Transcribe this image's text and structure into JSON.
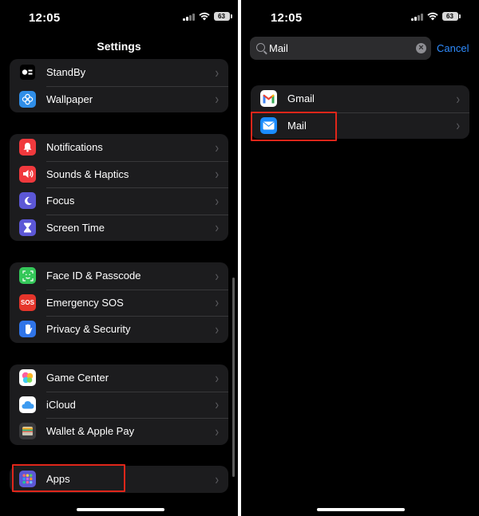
{
  "left_screen": {
    "status": {
      "time": "12:05",
      "battery": "63"
    },
    "title": "Settings",
    "groups": [
      {
        "items": [
          {
            "label": "StandBy",
            "icon": "standby-icon",
            "color": "#1c1c1e"
          },
          {
            "label": "Wallpaper",
            "icon": "wallpaper-icon",
            "color": "#2f8ee8"
          }
        ]
      },
      {
        "items": [
          {
            "label": "Notifications",
            "icon": "bell-icon",
            "color": "#f0393d"
          },
          {
            "label": "Sounds & Haptics",
            "icon": "speaker-icon",
            "color": "#f0393d"
          },
          {
            "label": "Focus",
            "icon": "moon-icon",
            "color": "#5c57d6"
          },
          {
            "label": "Screen Time",
            "icon": "hourglass-icon",
            "color": "#5c57d6"
          }
        ]
      },
      {
        "items": [
          {
            "label": "Face ID & Passcode",
            "icon": "faceid-icon",
            "color": "#34c759"
          },
          {
            "label": "Emergency SOS",
            "icon": "sos-icon",
            "color": "#e5352b",
            "icon_text": "SOS"
          },
          {
            "label": "Privacy & Security",
            "icon": "hand-icon",
            "color": "#2f74e8"
          }
        ]
      },
      {
        "items": [
          {
            "label": "Game Center",
            "icon": "game-center-icon",
            "color": "#ffffff"
          },
          {
            "label": "iCloud",
            "icon": "cloud-icon",
            "color": "#ffffff"
          },
          {
            "label": "Wallet & Apple Pay",
            "icon": "wallet-icon",
            "color": "#3a3a3c"
          }
        ]
      },
      {
        "items": [
          {
            "label": "Apps",
            "icon": "apps-grid-icon",
            "color": "#5c57d6"
          }
        ]
      }
    ]
  },
  "right_screen": {
    "status": {
      "time": "12:05",
      "battery": "63"
    },
    "search": {
      "value": "Mail"
    },
    "cancel_label": "Cancel",
    "results": [
      {
        "label": "Gmail",
        "icon": "gmail-icon",
        "color": "#ffffff"
      },
      {
        "label": "Mail",
        "icon": "mail-envelope-icon",
        "color": "#1a8cff"
      }
    ]
  },
  "highlight_color": "#e0261a"
}
